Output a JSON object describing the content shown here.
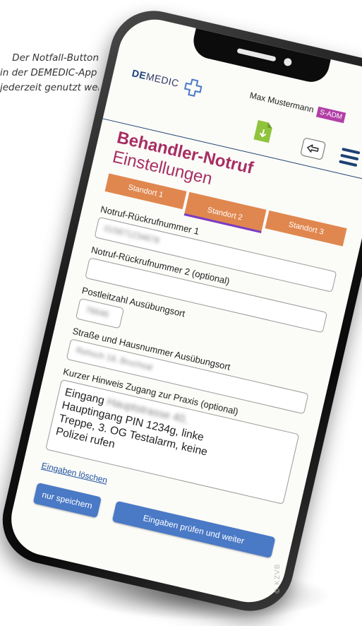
{
  "caption": {
    "line1": "Der Notfall-Button",
    "line2": "in der DEMEDIC-App kann",
    "line3": "jederzeit genutzt werden."
  },
  "app": {
    "logo_prefix": "DE",
    "logo_suffix": "MEDIC",
    "user_name": "Max Mustermann",
    "user_role": "S-ADM",
    "title_bold": "Behandler-Notruf",
    "title_rest": " Einstellungen"
  },
  "tabs": [
    {
      "label": "Standort 1",
      "active": false
    },
    {
      "label": "Standort 2",
      "active": true
    },
    {
      "label": "Standort 3",
      "active": false
    }
  ],
  "form": {
    "callback1_label": "Notruf-Rückrufnummer 1",
    "callback1_value": "015871234678",
    "callback2_label": "Notruf-Rückrufnummer 2 (optional)",
    "callback2_value": "",
    "zip_label": "Postleitzahl Ausübungsort",
    "zip_value": "76646",
    "street_label": "Straße und Hausnummer Ausübungsort",
    "street_value": "Rehsch 18, Bruchsal",
    "hint_label": "Kurzer Hinweis Zugang zur Praxis (optional)",
    "hint_line1_prefix": "Eingang ",
    "hint_line1_blur": "Hauptstrasse 40,",
    "hint_line2": "Hauptingang PIN 1234g, linke",
    "hint_line3": "Treppe, 3. OG Testalarm, keine",
    "hint_line4": "Polizei rufen"
  },
  "actions": {
    "clear_link": "Eingaben löschen",
    "save_only": "nur speichern",
    "check_continue": "Eingaben prüfen und weiter"
  },
  "watermark": "© KZVB",
  "colors": {
    "brand_blue": "#1d4172",
    "title_magenta": "#a72e62",
    "tab_orange": "#e0874f",
    "tab_active_underline": "#7a3cc6",
    "button_blue": "#4a79c6",
    "role_badge": "#b23fa6"
  }
}
